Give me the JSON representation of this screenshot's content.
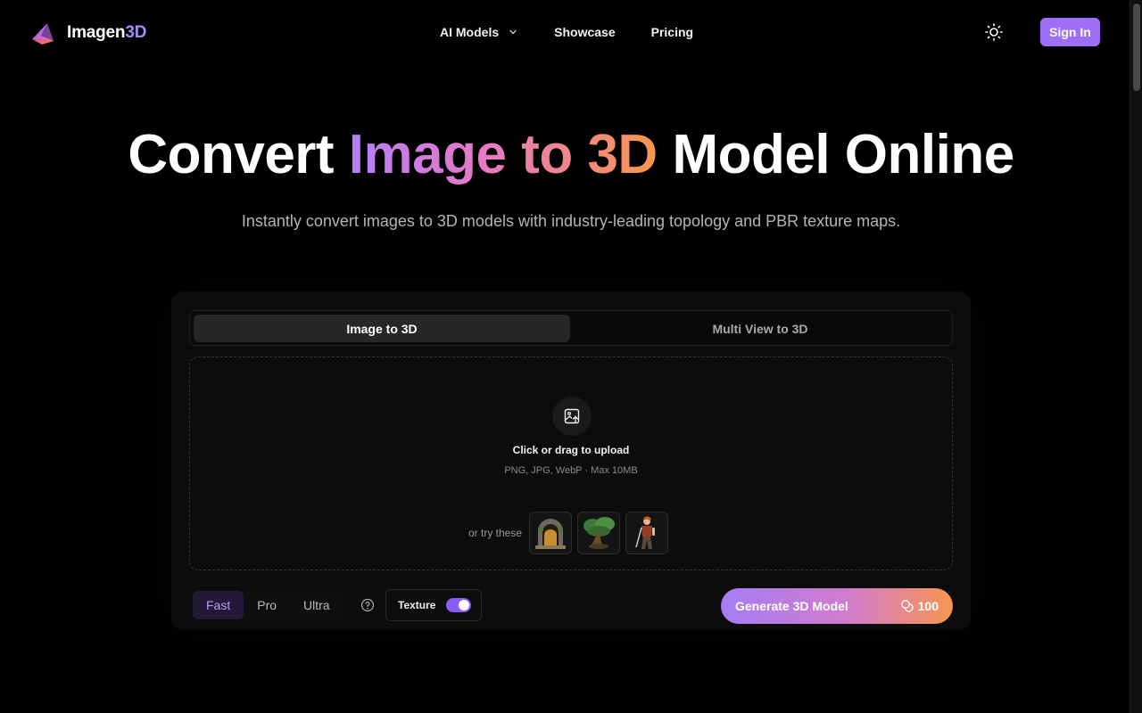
{
  "brand": {
    "name_main": "Imagen",
    "name_accent": "3D"
  },
  "nav": {
    "items": [
      {
        "label": "AI Models",
        "icon": "chevron-down-icon"
      },
      {
        "label": "Showcase"
      },
      {
        "label": "Pricing"
      }
    ]
  },
  "header": {
    "theme_icon": "sun-icon",
    "signin_label": "Sign In"
  },
  "hero": {
    "title_start": "Convert ",
    "title_highlight": "Image to 3D",
    "title_end": " Model Online",
    "subtitle": "Instantly convert images to 3D models with industry-leading topology and PBR texture maps."
  },
  "tabs": [
    {
      "label": "Image to 3D",
      "active": true
    },
    {
      "label": "Multi View to 3D",
      "active": false
    }
  ],
  "upload": {
    "icon": "image-upload-icon",
    "title": "Click or drag to upload",
    "hint": "PNG, JPG, WebP · Max 10MB",
    "samples_label": "or try these",
    "samples": [
      "stone-portal-sample",
      "bonsai-tree-sample",
      "warrior-character-sample"
    ]
  },
  "modes": [
    {
      "label": "Fast",
      "active": true
    },
    {
      "label": "Pro",
      "active": false
    },
    {
      "label": "Ultra",
      "active": false
    }
  ],
  "texture": {
    "label": "Texture",
    "enabled": true
  },
  "generate": {
    "label": "Generate 3D Model",
    "credits": "100",
    "credits_icon": "coins-icon"
  },
  "colors": {
    "accent": "#9f6ef6",
    "gradient_start": "#b57ef8",
    "gradient_mid": "#e879c2",
    "gradient_end": "#f9964b"
  }
}
